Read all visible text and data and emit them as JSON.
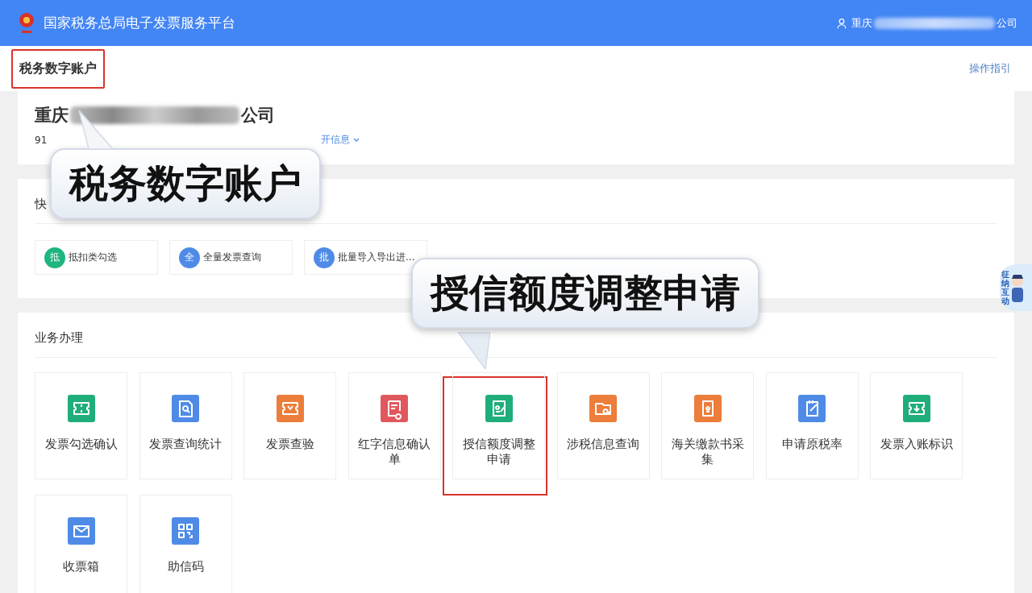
{
  "header": {
    "title": "国家税务总局电子发票服务平台",
    "user_prefix": "重庆",
    "user_suffix": "公司"
  },
  "subheader": {
    "title": "税务数字账户",
    "highlighted": true,
    "guide_link": "操作指引"
  },
  "company": {
    "name_prefix": "重庆",
    "name_suffix": "公司",
    "id_prefix": "91",
    "expand_link": "开信息"
  },
  "quick": {
    "title": "快",
    "items": [
      {
        "badge": "抵",
        "label": "抵扣类勾选",
        "color": "#1fb57e"
      },
      {
        "badge": "全",
        "label": "全量发票查询",
        "color": "#4f8be6"
      },
      {
        "badge": "批",
        "label": "批量导入导出进...",
        "color": "#4f8be6"
      }
    ]
  },
  "business": {
    "title": "业务办理",
    "tiles": [
      {
        "label": "发票勾选确认",
        "color": "#1fae7a",
        "highlighted": false
      },
      {
        "label": "发票查询统计",
        "color": "#4f8be6",
        "highlighted": false
      },
      {
        "label": "发票查验",
        "color": "#ec7d3a",
        "highlighted": false
      },
      {
        "label": "红字信息确认单",
        "color": "#e0585d",
        "highlighted": false
      },
      {
        "label": "授信额度调整申请",
        "color": "#1fae7a",
        "highlighted": true
      },
      {
        "label": "涉税信息查询",
        "color": "#ec7d3a",
        "highlighted": false
      },
      {
        "label": "海关缴款书采集",
        "color": "#ec7d3a",
        "highlighted": false
      },
      {
        "label": "申请原税率",
        "color": "#4f8be6",
        "highlighted": false
      },
      {
        "label": "发票入账标识",
        "color": "#1fae7a",
        "highlighted": false
      },
      {
        "label": "收票箱",
        "color": "#4f8be6",
        "highlighted": false
      },
      {
        "label": "助信码",
        "color": "#4f8be6",
        "highlighted": false
      }
    ]
  },
  "widget": {
    "label": "征纳互动"
  },
  "callouts": [
    {
      "text": "税务数字账户",
      "kind": "up"
    },
    {
      "text": "授信额度调整申请",
      "kind": "down"
    }
  ]
}
